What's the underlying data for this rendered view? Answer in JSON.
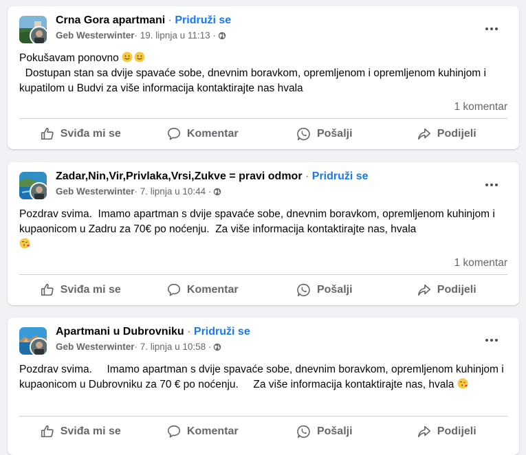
{
  "posts": [
    {
      "group_name": "Crna Gora apartmani",
      "separator": " · ",
      "join_label": "Pridruži se",
      "author": "Geb Westerwinter",
      "date": " · 19. lipnja u 11:13 · ",
      "privacy_icon": "globe-icon",
      "text_line1": "Pokušavam ponovno ",
      "text_rest": "  Dostupan stan sa dvije spavaće sobe, dnevnim boravkom, opremljenom i opremljenom kuhinjom i kupatilom u Budvi za više informacija kontaktirajte nas hvala",
      "comments": "1 komentar",
      "emojis": [
        "slightly-smiling-face",
        "slightly-smiling-face"
      ]
    },
    {
      "group_name": "Zadar,Nin,Vir,Privlaka,Vrsi,Zukve = pravi odmor",
      "separator": " · ",
      "join_label": "Pridruži se",
      "author": "Geb Westerwinter",
      "date": " · 7. lipnja u 10:44 · ",
      "privacy_icon": "globe-icon",
      "text": "Pozdrav svima.  Imamo apartman s dvije spavaće sobe, dnevnim boravkom, opremljenom kuhinjom i kupaonicom u Zadru za 70€ po noćenju.  Za više informacija kontaktirajte nas, hvala",
      "comments": "1 komentar",
      "emojis": [
        "face-blowing-kiss"
      ]
    },
    {
      "group_name": "Apartmani u Dubrovniku",
      "separator": " · ",
      "join_label": "Pridruži se",
      "author": "Geb Westerwinter",
      "date": " · 7. lipnja u 10:58 · ",
      "privacy_icon": "globe-icon",
      "text": "Pozdrav svima.     Imamo apartman s dvije spavaće sobe, dnevnim boravkom, opremljenom kuhinjom i kupaonicom u Dubrovniku za 70 € po noćenju.     Za više informacija kontaktirajte nas, hvala",
      "emojis": [
        "face-blowing-kiss"
      ]
    }
  ],
  "actions": {
    "like": "Sviđa mi se",
    "comment": "Komentar",
    "send": "Pošalji",
    "share": "Podijeli"
  },
  "colors": {
    "page_bg": "#f0f2f5",
    "card_bg": "#ffffff",
    "link_blue": "#1877f2",
    "secondary_text": "#65676b"
  }
}
